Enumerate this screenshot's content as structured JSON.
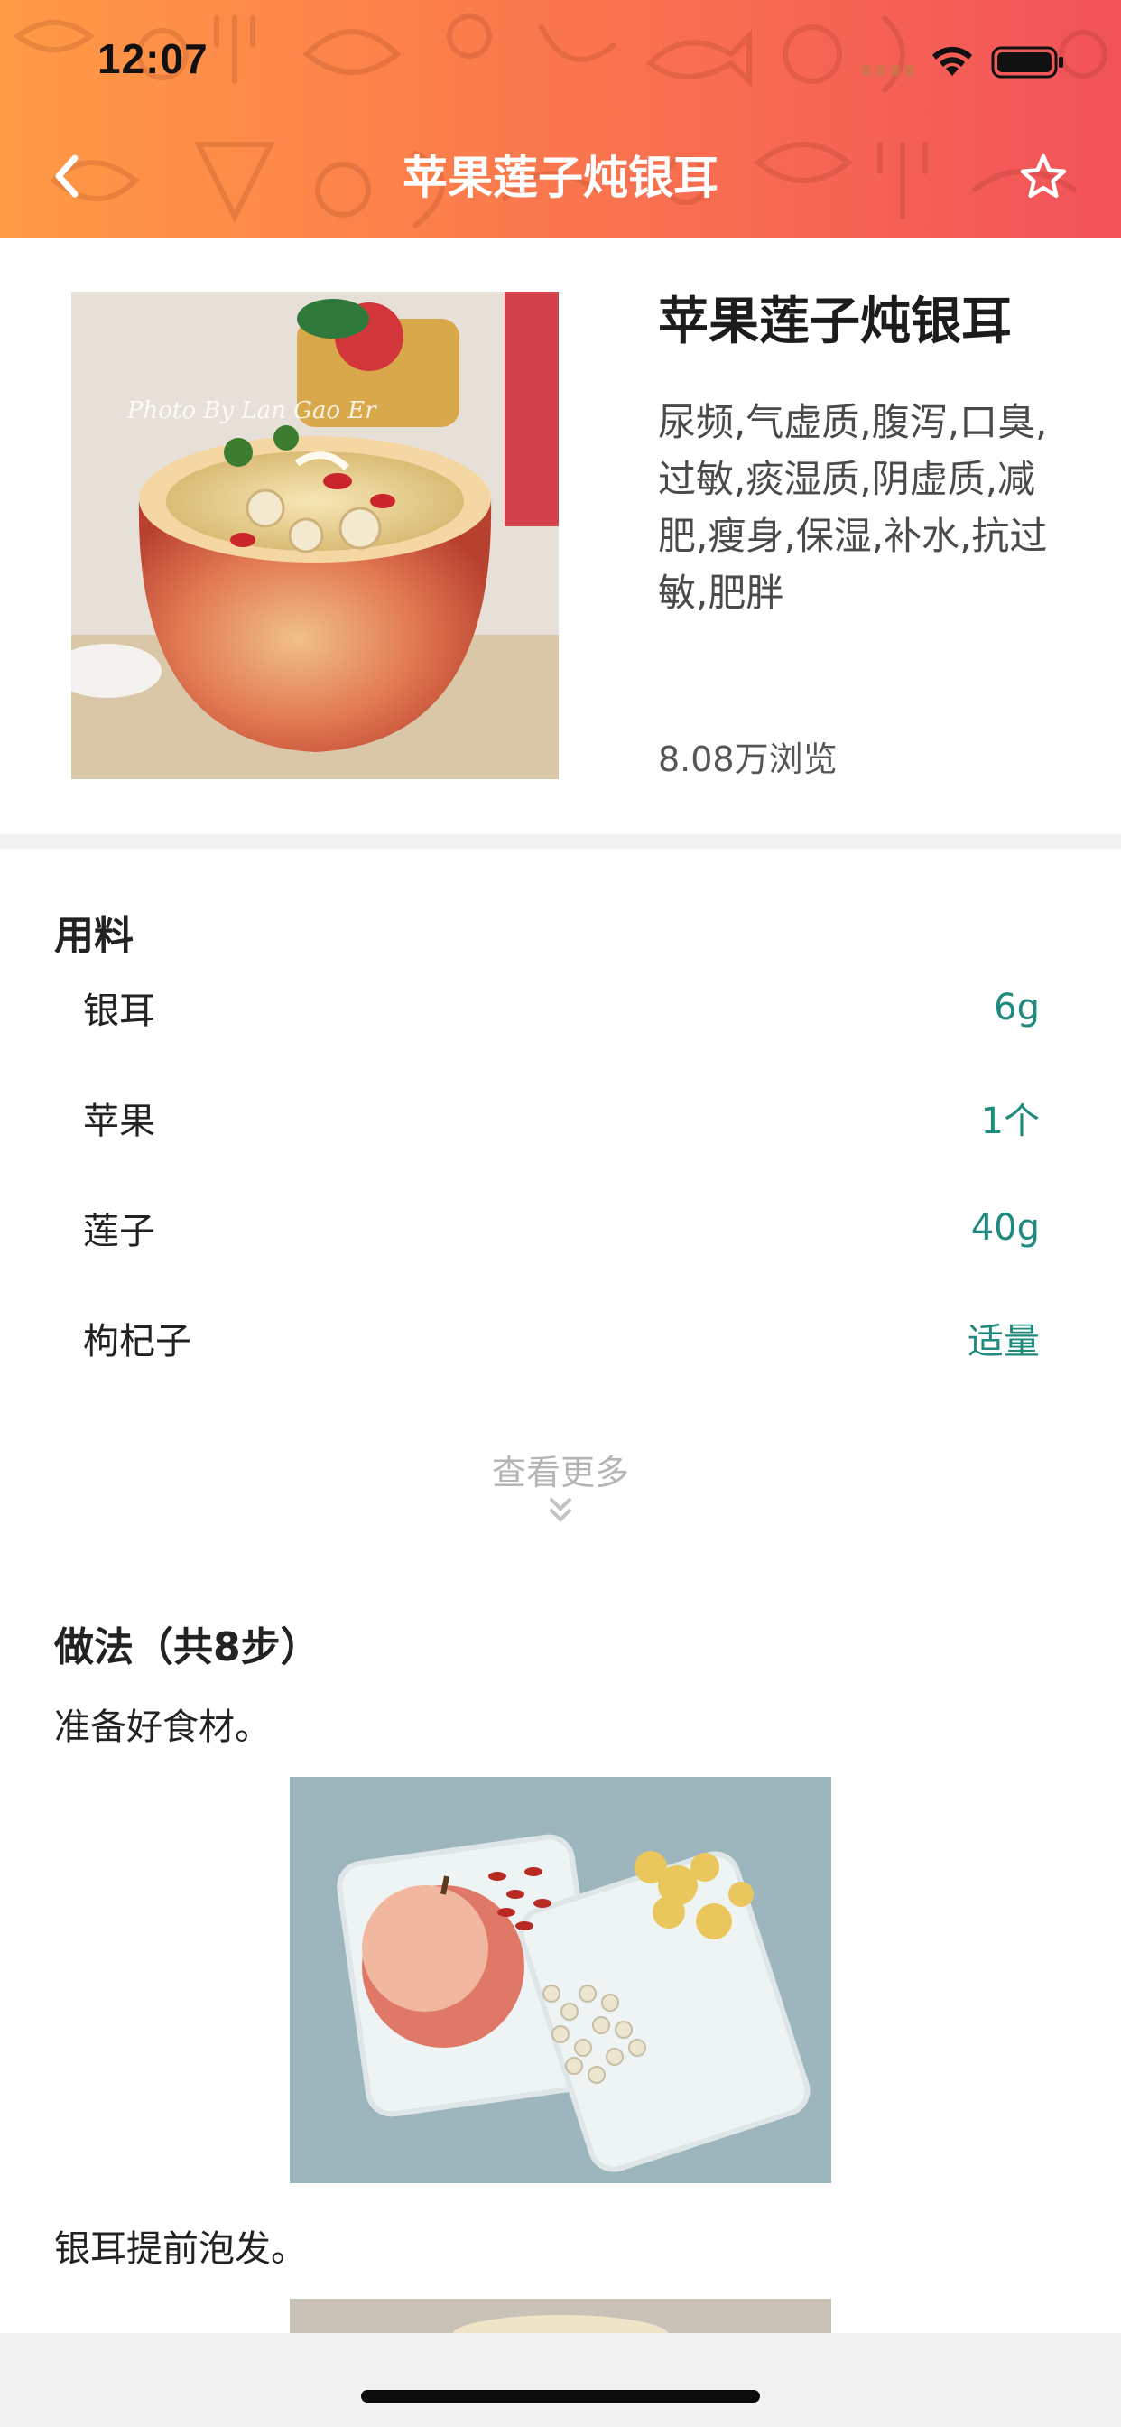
{
  "status_bar": {
    "time": "12:07"
  },
  "nav": {
    "title": "苹果莲子炖银耳"
  },
  "recipe": {
    "title": "苹果莲子炖银耳",
    "tags": "尿频,气虚质,腹泻,口臭,过敏,痰湿质,阴虚质,减肥,瘦身,保湿,补水,抗过敏,肥胖",
    "views": "8.08万浏览",
    "photo_watermark": "Photo By Lan Gao Er"
  },
  "ingredients": {
    "title": "用料",
    "items": [
      {
        "name": "银耳",
        "amount": "6g"
      },
      {
        "name": "苹果",
        "amount": "1个"
      },
      {
        "name": "莲子",
        "amount": "40g"
      },
      {
        "name": "枸杞子",
        "amount": "适量"
      }
    ],
    "more_label": "查看更多"
  },
  "steps": {
    "title": "做法（共8步）",
    "items": [
      {
        "text": "准备好食材。"
      },
      {
        "text": "银耳提前泡发。"
      }
    ]
  },
  "colors": {
    "header_start": "#ff9a45",
    "header_end": "#f2525a",
    "amount_teal": "#1f8a7e"
  },
  "icons": {
    "back": "chevron-left-icon",
    "favorite": "star-outline-icon",
    "more": "double-chevron-down-icon"
  }
}
